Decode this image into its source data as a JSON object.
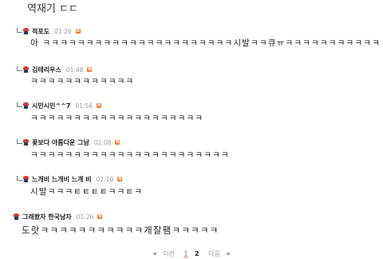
{
  "header": {
    "title": "역재기 ㄷㄷ"
  },
  "comments": [
    {
      "nick": "적포도",
      "time": "01:26",
      "badge": "N",
      "body": "아 ㅋㅋㅋㅋㅋㅋㅋㅋㅋㅋㅋㅋㅋㅋㅋㅋㅋㅋㅋㅋㅋㅋ시발ㅋㅋ큐ㅠㅋㅋㅋㅋㅋㅋㅋㅋㅋㅋㅋ",
      "reply": true
    },
    {
      "nick": "김테리우스",
      "time": "01:48",
      "badge": "N",
      "body": "ㅋㅋㅋㅋㅋㅋㅋㅋㅋㅋㅋㅋ",
      "reply": true
    },
    {
      "nick": "시민시민^^7",
      "time": "01:56",
      "badge": "N",
      "body": "ㅋㅋㅋㅋㅋㅋㅋㅋㅋㅋㅋㅋㅋㅋㅋㅋㅋㅋㅋㅋ",
      "reply": true
    },
    {
      "nick": "꽃보다 아름다운 그남",
      "time": "02:08",
      "badge": "N",
      "body": "ㅋㅋㅋㅋㅋㅋㅋㅋㅋㅋㅋㅋㅋㅋㅋㅋㅋㅋㅋㅋㅋㅋㅋ",
      "reply": true
    },
    {
      "nick": "느개비 느개비 느개 비",
      "time": "02:10",
      "badge": "N",
      "body": "시발ㅋㅋㅋㅌㅌㅌㅌㅋㅋㅌㅋ",
      "reply": true
    },
    {
      "nick": "그래봤자 한국남자",
      "time": "01:26",
      "badge": "N",
      "body": "도랏ㅋㅋㅋㅋㅋㅋㅋㅋㅋㅋㅋ개잘팸ㅋㅋㅋㅋㅋ",
      "reply": false
    }
  ],
  "pagination": {
    "prev": "이전",
    "pages": [
      "1",
      "2"
    ],
    "next": "다음",
    "prev_arrow": "◀",
    "next_arrow": "▶"
  },
  "colors": {
    "badge": "#f07b2e",
    "current_page": "#d9534f",
    "avatar_hat": "#d43a2c"
  }
}
